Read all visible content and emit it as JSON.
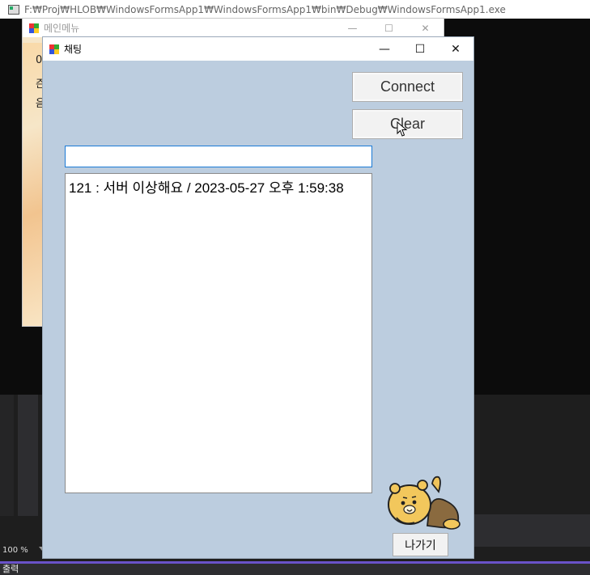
{
  "console": {
    "title": "F:₩Proj₩HLOB₩WindowsFormsApp1₩WindowsFormsApp1₩bin₩Debug₩WindowsFormsApp1.exe"
  },
  "main_menu": {
    "title": "메인메뉴",
    "partial_lines": [
      "0",
      "즌",
      "읃"
    ],
    "controls": {
      "minimize": "—",
      "maximize": "☐",
      "close": "✕"
    }
  },
  "chat": {
    "title": "채팅",
    "controls": {
      "minimize": "—",
      "maximize": "☐",
      "close": "✕"
    },
    "connect_label": "Connect",
    "clear_label": "Clear",
    "input_value": "",
    "messages": [
      "121 : 서버 이상해요 / 2023-05-27 오후 1:59:38"
    ],
    "exit_label": "나가기"
  },
  "ide": {
    "zoom": "100 %",
    "output_tab": "출력"
  }
}
